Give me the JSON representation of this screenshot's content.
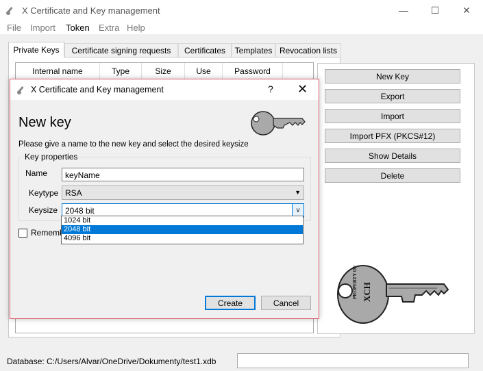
{
  "window": {
    "title": "X Certificate and Key management",
    "controls": [
      "minimize-icon",
      "maximize-icon",
      "close-icon"
    ]
  },
  "menu": [
    "File",
    "Import",
    "Token",
    "Extra",
    "Help"
  ],
  "tabs": [
    "Private Keys",
    "Certificate signing requests",
    "Certificates",
    "Templates",
    "Revocation lists"
  ],
  "list_columns": [
    "Internal name",
    "Type",
    "Size",
    "Use",
    "Password"
  ],
  "side_buttons": [
    "New Key",
    "Export",
    "Import",
    "Import PFX (PKCS#12)",
    "Show Details",
    "Delete"
  ],
  "status": {
    "database": "Database: C:/Users/Alvar/OneDrive/Dokumenty/test1.xdb",
    "field": ""
  },
  "dialog": {
    "title": "X Certificate and Key management",
    "help": "?",
    "close": "✕",
    "heading": "New key",
    "instruction": "Please give a name to the new key and select the desired keysize",
    "group_title": "Key properties",
    "name_label": "Name",
    "name_value": "keyName",
    "keytype_label": "Keytype",
    "keytype_value": "RSA",
    "keysize_label": "Keysize",
    "keysize_value": "2048 bit",
    "keysize_options": [
      "1024 bit",
      "2048 bit",
      "4096 bit"
    ],
    "keysize_selected_index": 1,
    "remember_label": "Remember",
    "remember_checked": false,
    "create_label": "Create",
    "cancel_label": "Cancel"
  },
  "key_badge_text": [
    "PROPERTY OF",
    "XCH"
  ],
  "colors": {
    "accent": "#0078d7",
    "dialog_border": "#e06070",
    "key_fill": "#a9a9a9"
  }
}
